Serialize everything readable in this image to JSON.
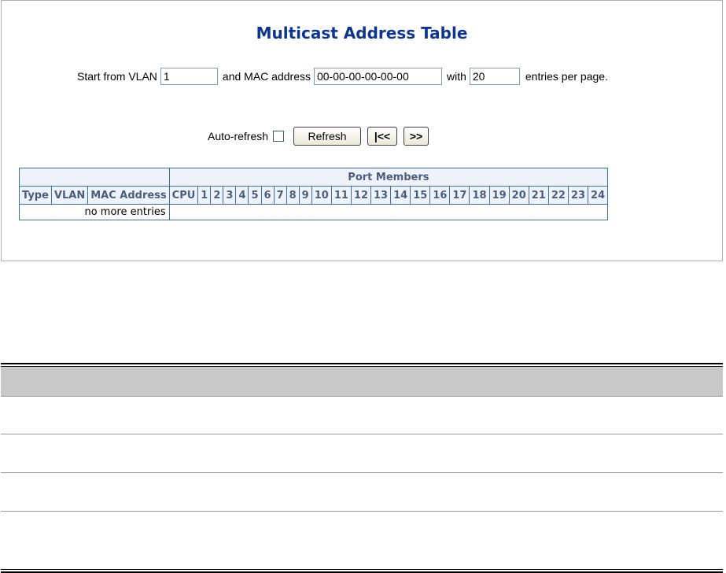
{
  "page_title": "Multicast Address Table",
  "controls": {
    "start_label": "Start from VLAN",
    "vlan_value": "1",
    "mac_label": "and MAC address",
    "mac_value": "00-00-00-00-00-00",
    "with_label": "with",
    "entries_value": "20",
    "entries_label": "entries per page."
  },
  "toolbar": {
    "auto_refresh_label": "Auto-refresh",
    "refresh_label": "Refresh",
    "first_label": "|<<",
    "next_label": ">>"
  },
  "table": {
    "group_header": "Port Members",
    "columns": [
      "Type",
      "VLAN",
      "MAC Address",
      "CPU",
      "1",
      "2",
      "3",
      "4",
      "5",
      "6",
      "7",
      "8",
      "9",
      "10",
      "11",
      "12",
      "13",
      "14",
      "15",
      "16",
      "17",
      "18",
      "19",
      "20",
      "21",
      "22",
      "23",
      "24"
    ],
    "empty_message": "no more entries"
  },
  "colors": {
    "title": "#0d3590",
    "table_border": "#3a6ea5",
    "header_bg": "#eef3fb",
    "header_text": "#4b5d7d",
    "doc_header_bg": "#c9c9c9"
  }
}
